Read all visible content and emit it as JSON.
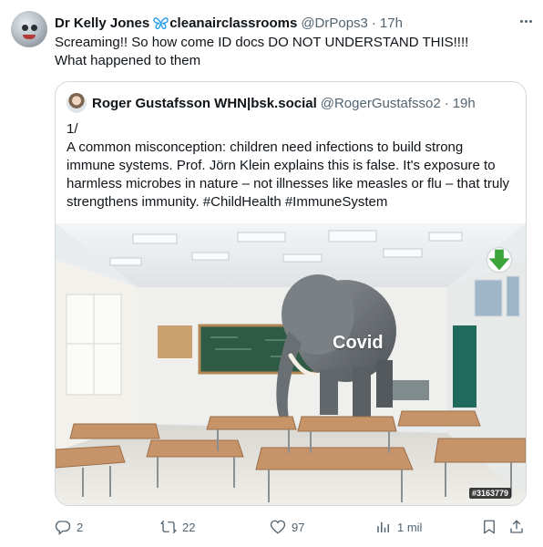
{
  "post": {
    "author_name": "Dr Kelly Jones",
    "author_name_suffix": "cleanairclassrooms",
    "handle": "@DrPops3",
    "separator": "·",
    "time": "17h",
    "text": "Screaming!! So how come ID docs DO NOT UNDERSTAND THIS!!!! What happened to them"
  },
  "quote": {
    "author_name": "Roger Gustafsson WHN|bsk.social",
    "handle": "@RogerGustafsso2",
    "separator": "·",
    "time": "19h",
    "text_lines": [
      "1/",
      "A common misconception: children need infections to build strong",
      "immune systems. Prof. Jörn Klein explains this is false. It's exposure to",
      "harmless microbes in nature – not illnesses like measles or flu – that truly",
      "strengthens immunity. #ChildHealth #ImmuneSystem"
    ],
    "image": {
      "overlay_label": "Covid",
      "stock_id": "#3163779"
    }
  },
  "actions": {
    "replies": "2",
    "reposts": "22",
    "likes": "97",
    "views": "1 mil"
  },
  "icons": [
    "butterfly-icon",
    "more-icon",
    "download-icon",
    "reply-icon",
    "repost-icon",
    "like-icon",
    "views-icon",
    "bookmark-icon",
    "share-icon"
  ],
  "colors": {
    "text": "#0f1419",
    "secondary": "#536471",
    "border": "#cfd9de",
    "butterfly": "#1d9bf0",
    "download": "#3ba53b"
  }
}
